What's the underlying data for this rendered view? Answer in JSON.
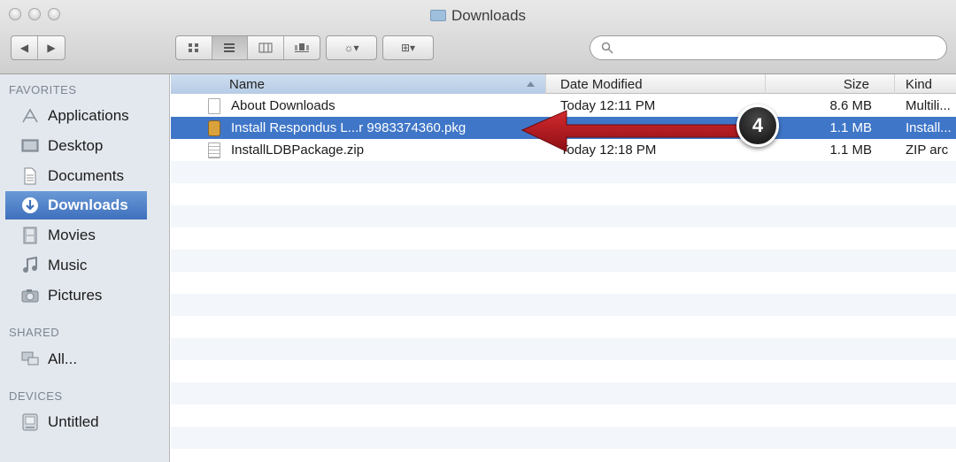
{
  "window": {
    "title": "Downloads"
  },
  "toolbar": {
    "nav": [
      "◀",
      "▶"
    ],
    "views": [
      "icon",
      "list",
      "column",
      "coverflow"
    ],
    "action_label": "☼▾",
    "arrange_label": "⊞▾",
    "search_placeholder": ""
  },
  "sidebar": {
    "favorites_label": "FAVORITES",
    "shared_label": "SHARED",
    "devices_label": "DEVICES",
    "favorites": [
      {
        "label": "Applications",
        "icon": "applications-icon"
      },
      {
        "label": "Desktop",
        "icon": "desktop-icon"
      },
      {
        "label": "Documents",
        "icon": "documents-icon"
      },
      {
        "label": "Downloads",
        "icon": "downloads-icon"
      },
      {
        "label": "Movies",
        "icon": "movies-icon"
      },
      {
        "label": "Music",
        "icon": "music-icon"
      },
      {
        "label": "Pictures",
        "icon": "pictures-icon"
      }
    ],
    "shared": [
      {
        "label": "All...",
        "icon": "network-icon"
      }
    ],
    "devices": [
      {
        "label": "Untitled",
        "icon": "disk-icon"
      }
    ]
  },
  "columns": {
    "name": "Name",
    "date": "Date Modified",
    "size": "Size",
    "kind": "Kind"
  },
  "files": [
    {
      "name": "About Downloads",
      "date": "Today 12:11 PM",
      "size": "8.6 MB",
      "kind": "Multili..."
    },
    {
      "name": "Install Respondus L...r 9983374360.pkg",
      "date": "",
      "size": "1.1 MB",
      "kind": "Install..."
    },
    {
      "name": "InstallLDBPackage.zip",
      "date": "Today 12:18 PM",
      "size": "1.1 MB",
      "kind": "ZIP arc"
    }
  ],
  "annotation": {
    "step": "4"
  },
  "colors": {
    "selection": "#3f76c8",
    "sidebar_bg": "#e3e8ee",
    "arrow": "#b3151c"
  }
}
